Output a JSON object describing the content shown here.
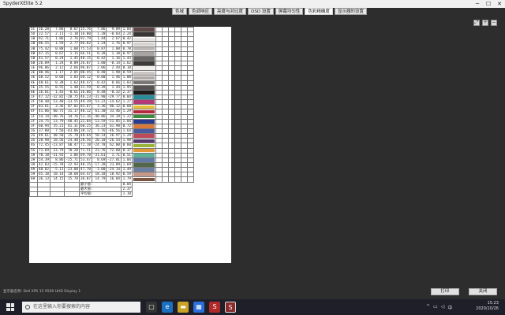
{
  "window": {
    "title": "SpyderXElite 5.2"
  },
  "tabs": [
    {
      "label": "色域"
    },
    {
      "label": "色调响应"
    },
    {
      "label": "亮度与对比度"
    },
    {
      "label": "OSD 设置"
    },
    {
      "label": "屏幕均匀性"
    },
    {
      "label": "色彩精确度"
    },
    {
      "label": "显示器的设置"
    }
  ],
  "colors": {
    "dark": "#2d2d2d",
    "tab_bg": "#e8e8e8",
    "taskbar": "#1f1f2a"
  },
  "rows": [
    {
      "id": "5C",
      "v": [
        "16.28",
        "7.86",
        "8.67",
        "15.76",
        "7.86",
        "9.09"
      ],
      "de": "1.04",
      "color": "#5c4646"
    },
    {
      "id": "5D",
      "v": [
        "22.57",
        "2.11",
        "-1.10",
        "16.80",
        "1.28",
        "-0.83"
      ],
      "de": "2.24",
      "color": "#3b3636"
    },
    {
      "id": "1B",
      "v": [
        "92.71",
        "1.86",
        "2.76",
        "92.79",
        "1.44",
        "2.67",
        "0.42"
      ],
      "de": "",
      "color": "#e8e4e2"
    },
    {
      "id": "2B",
      "v": [
        "86.55",
        "1.59",
        "2.77",
        "86.82",
        "1.24",
        "1.76",
        "0.97"
      ],
      "de": "",
      "color": "#d6d2d0"
    },
    {
      "id": "3B",
      "v": [
        "75.42",
        "0.88",
        "1.88",
        "75.53",
        "0.87",
        "1.00",
        "0.78"
      ],
      "de": "",
      "color": "#bdb9b7"
    },
    {
      "id": "4B",
      "v": [
        "67.15",
        "0.67",
        "1.15",
        "66.51",
        "0.28",
        "1.10",
        "0.97"
      ],
      "de": "",
      "color": "#a8a4a3"
    },
    {
      "id": "5B",
      "v": [
        "41.57",
        "0.24",
        "1.45",
        "40.15",
        "-0.42",
        "1.16",
        "1.43"
      ],
      "de": "",
      "color": "#6a6665"
    },
    {
      "id": "6B",
      "v": [
        "26.09",
        "1.24",
        "0.09",
        "26.07",
        "1.00",
        "-0.14",
        "1.62"
      ],
      "de": "",
      "color": "#3e3b3b"
    },
    {
      "id": "1E",
      "v": [
        "96.06",
        "2.12",
        "2.66",
        "96.07",
        "2.06",
        "2.44",
        "0.18"
      ],
      "de": "",
      "color": "#f2eeec"
    },
    {
      "id": "2E",
      "v": [
        "80.46",
        "1.17",
        "2.05",
        "80.45",
        "0.48",
        "1.98",
        "0.59"
      ],
      "de": "",
      "color": "#cac6c4"
    },
    {
      "id": "3E",
      "v": [
        "68.52",
        "0.68",
        "1.83",
        "68.12",
        "-0.00",
        "1.46",
        "1.08"
      ],
      "de": "",
      "color": "#aeaaa8"
    },
    {
      "id": "4E",
      "v": [
        "48.61",
        "0.38",
        "1.62",
        "48.47",
        "-0.42",
        "0.66",
        "1.83"
      ],
      "de": "",
      "color": "#7c7876"
    },
    {
      "id": "5E",
      "v": [
        "35.55",
        "0.55",
        "1.40",
        "31.59",
        "-0.39",
        "1.44",
        "1.95"
      ],
      "de": "",
      "color": "#575352"
    },
    {
      "id": "6E",
      "v": [
        "16.81",
        "1.43",
        "-0.61",
        "16.06",
        "0.48",
        "-0.32",
        "2.37"
      ],
      "de": "",
      "color": "#1d1b1c"
    },
    {
      "id": "1F",
      "v": [
        "47.12",
        "-32.82",
        "-28.75",
        "46.23",
        "-31.90",
        "-29.77",
        "0.84"
      ],
      "de": "",
      "color": "#2a8c9a"
    },
    {
      "id": "2F",
      "v": [
        "50.48",
        "53.48",
        "-13.55",
        "49.39",
        "53.22",
        "-14.62",
        "1.27"
      ],
      "de": "",
      "color": "#b33b7a"
    },
    {
      "id": "3F",
      "v": [
        "83.61",
        "3.36",
        "87.02",
        "83.67",
        "3.36",
        "86.12",
        "0.60"
      ],
      "de": "",
      "color": "#e6c23a"
    },
    {
      "id": "4F",
      "v": [
        "41.06",
        "60.75",
        "31.17",
        "40.12",
        "61.30",
        "33.46",
        "1.29"
      ],
      "de": "",
      "color": "#b32a3a"
    },
    {
      "id": "1F",
      "v": [
        "54.14",
        "-40.76",
        "34.76",
        "53.16",
        "-40.86",
        "34.39",
        "1.22"
      ],
      "de": "",
      "color": "#3f8b3f"
    },
    {
      "id": "2F",
      "v": [
        "24.75",
        "13.79",
        "-48.45",
        "22.84",
        "13.59",
        "-51.85",
        "1.84"
      ],
      "de": "",
      "color": "#2a3a8f"
    },
    {
      "id": "3F",
      "v": [
        "60.94",
        "35.21",
        "61.31",
        "60.25",
        "36.23",
        "61.90",
        "0.72"
      ],
      "de": "",
      "color": "#d9793a"
    },
    {
      "id": "1G",
      "v": [
        "37.80",
        "7.50",
        "-43.06",
        "38.12",
        "7.76",
        "-46.56",
        "1.64"
      ],
      "de": "",
      "color": "#4b5a9e"
    },
    {
      "id": "2G",
      "v": [
        "49.61",
        "48.50",
        "15.78",
        "48.64",
        "50.14",
        "16.97",
        "1.29"
      ],
      "de": "",
      "color": "#c04a5c"
    },
    {
      "id": "3G",
      "v": [
        "28.98",
        "18.56",
        "-24.48",
        "28.56",
        "20.10",
        "-26.54",
        "1.98"
      ],
      "de": "",
      "color": "#5a3a6e"
    },
    {
      "id": "4G",
      "v": [
        "72.45",
        "-23.87",
        "60.47",
        "72.18",
        "-24.78",
        "62.00",
        "0.60"
      ],
      "de": "",
      "color": "#9bb53a"
    },
    {
      "id": "5G",
      "v": [
        "71.69",
        "23.79",
        "70.28",
        "71.51",
        "23.76",
        "72.60",
        "0.37"
      ],
      "de": "",
      "color": "#e29a36"
    },
    {
      "id": "1H",
      "v": [
        "70.18",
        "-31.93",
        "1.86",
        "69.70",
        "-31.61",
        "1.71",
        "0.51"
      ],
      "de": "",
      "color": "#5eb09a"
    },
    {
      "id": "2H",
      "v": [
        "54.39",
        "8.86",
        "-25.71",
        "53.47",
        "8.69",
        "-27.01",
        "1.04"
      ],
      "de": "",
      "color": "#5f7aa8"
    },
    {
      "id": "3H",
      "v": [
        "42.03",
        "-15.78",
        "22.93",
        "40.15",
        "-17.28",
        "23.89",
        "1.69"
      ],
      "de": "",
      "color": "#52684a"
    },
    {
      "id": "4H",
      "v": [
        "48.82",
        "-5.11",
        "-23.08",
        "47.70",
        "-3.00",
        "-24.14",
        "1.49"
      ],
      "de": "",
      "color": "#6a7fa2"
    },
    {
      "id": "5H",
      "v": [
        "65.10",
        "18.14",
        "18.68",
        "64.47",
        "18.18",
        "18.92",
        "0.59"
      ],
      "de": "",
      "color": "#c69a8a"
    },
    {
      "id": "6H",
      "v": [
        "36.13",
        "14.15",
        "15.78",
        "36.07",
        "14.79",
        "16.04",
        "1.79"
      ],
      "de": "",
      "color": "#7a5544"
    }
  ],
  "summary": [
    {
      "label": "最小值:",
      "value": "0.04"
    },
    {
      "label": "最大值:",
      "value": "2.37"
    },
    {
      "label": "平均值:",
      "value": "1.18"
    }
  ],
  "status": {
    "text": "显示器名称: Dell XPS 15 9500 UHD Display 1"
  },
  "buttons": {
    "print": "打印",
    "close": "关闭"
  },
  "taskbar": {
    "search_placeholder": "在这里输入你要搜索的内容",
    "time": "15:23",
    "date": "2020/10/26",
    "ime": "中"
  }
}
